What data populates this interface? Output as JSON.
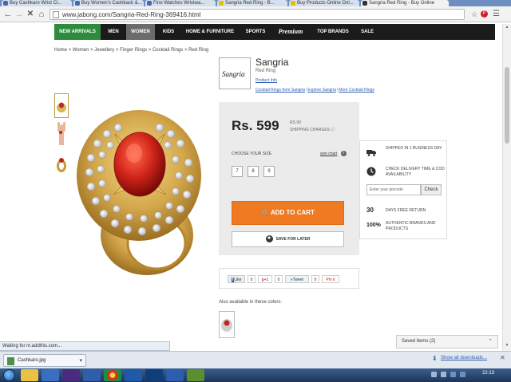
{
  "browser": {
    "tabs": [
      {
        "label": "Buy Cashkaro Wrist Cl...",
        "active": false
      },
      {
        "label": "Buy Women's Cashback &...",
        "active": false
      },
      {
        "label": "Fine Watches Wristwa...",
        "active": false
      },
      {
        "label": "Sangria Red Ring - B...",
        "active": false
      },
      {
        "label": "Buy Products Online Onl...",
        "active": false
      },
      {
        "label": "Sangria Red Ring - Buy Online",
        "active": true
      }
    ],
    "url": "www.jabong.com/Sangria-Red-Ring-369416.html",
    "status_text": "Waiting for m.addthis.com..."
  },
  "site_nav": {
    "items": [
      "NEW ARRIVALS",
      "MEN",
      "WOMEN",
      "KIDS",
      "HOME & FURNITURE",
      "SPORTS",
      "Premium",
      "TOP BRANDS",
      "SALE"
    ]
  },
  "breadcrumb": "Home > Women > Jewellery > Finger Rings > Cocktail Rings > Red Ring",
  "product": {
    "brand_logo_text": "Sangria",
    "brand": "Sangria",
    "subtitle": "Red Ring",
    "product_info": "Product Info",
    "brand_links": [
      "Cocktail Rings from Sangria",
      "Explore Sangria",
      "More Cocktail Rings"
    ],
    "price": "Rs. 599",
    "shipping_price": "RS.99",
    "shipping_label": "SHIPPING CHARGES",
    "choose_size_label": "CHOOSE YOUR SIZE",
    "size_chart_label": "size chart",
    "sizes": [
      "7",
      "8",
      "9"
    ],
    "add_to_cart": "ADD TO CART",
    "save_for_later": "SAVE FOR LATER"
  },
  "social": {
    "like": "Like",
    "like_count": "0",
    "plus": "+1",
    "plus_count": "0",
    "tweet": "Tweet",
    "tweet_count": "0",
    "pinit": "Pin it"
  },
  "delivery": {
    "shipping_text": "SHIPPED IN 1 BUSINESS DAY",
    "check_text": "CHECK DELIVERY TIME & COD AVAILABILITY",
    "pincode_placeholder": "Enter your pincode",
    "check_button": "Check",
    "return_days": "30",
    "return_text": "DAYS FREE RETURN",
    "authentic_pct": "100%",
    "authentic_text": "AUTHENTIC BRANDS AND PRODUCTS"
  },
  "also_available_label": "Also available in these colors:",
  "saved_items": "Saved Items (2)",
  "downloads": {
    "file_name": "Cashkaro.jpg",
    "show_all": "Show all downloads..."
  },
  "taskbar": {
    "clock": "22:13"
  },
  "colors": {
    "accent_orange": "#f07a22",
    "nav_green": "#2e8b3e",
    "nav_dark": "#1b1b1b"
  }
}
